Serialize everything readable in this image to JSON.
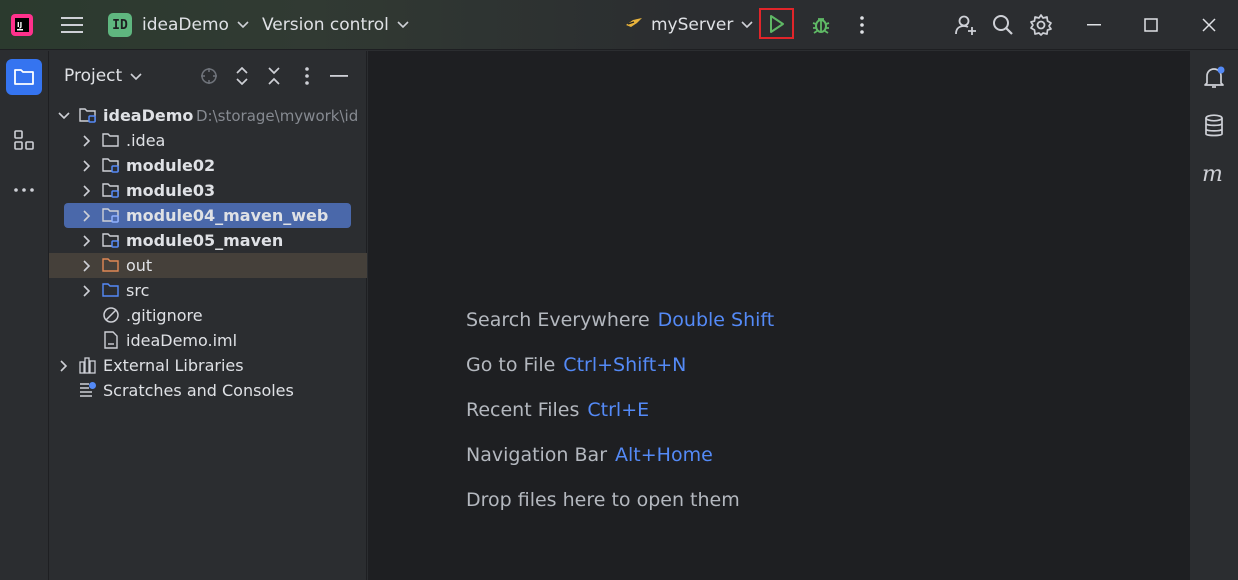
{
  "titlebar": {
    "project_badge": "ID",
    "project_name": "ideaDemo",
    "vcs_label": "Version control",
    "run_config": "myServer"
  },
  "project_panel": {
    "title": "Project"
  },
  "tree": [
    {
      "label": "ideaDemo",
      "path": "D:\\storage\\mywork\\id",
      "depth": 0,
      "expanded": true,
      "type": "module",
      "bold": true
    },
    {
      "label": ".idea",
      "depth": 1,
      "type": "folder"
    },
    {
      "label": "module02",
      "depth": 1,
      "type": "module",
      "bold": true
    },
    {
      "label": "module03",
      "depth": 1,
      "type": "module",
      "bold": true
    },
    {
      "label": "module04_maven_web",
      "depth": 1,
      "type": "module",
      "bold": true,
      "selected": true
    },
    {
      "label": "module05_maven",
      "depth": 1,
      "type": "module",
      "bold": true
    },
    {
      "label": "out",
      "depth": 1,
      "type": "excluded-folder",
      "excluded": true
    },
    {
      "label": "src",
      "depth": 1,
      "type": "source-folder"
    },
    {
      "label": ".gitignore",
      "depth": 1,
      "type": "ignore-file",
      "leaf": true
    },
    {
      "label": "ideaDemo.iml",
      "depth": 1,
      "type": "iml-file",
      "leaf": true
    },
    {
      "label": "External Libraries",
      "depth": 0,
      "type": "libraries"
    },
    {
      "label": "Scratches and Consoles",
      "depth": 0,
      "type": "scratches",
      "leaf": true
    }
  ],
  "editor_hints": [
    {
      "text": "Search Everywhere",
      "key": "Double Shift"
    },
    {
      "text": "Go to File",
      "key": "Ctrl+Shift+N"
    },
    {
      "text": "Recent Files",
      "key": "Ctrl+E"
    },
    {
      "text": "Navigation Bar",
      "key": "Alt+Home"
    },
    {
      "text": "Drop files here to open them",
      "key": ""
    }
  ],
  "colors": {
    "accent": "#3574f0",
    "run_highlight": "#e0252a",
    "run_green": "#5fb865",
    "shortcut": "#548af7"
  },
  "icons": {
    "left_strip": [
      "project-folder-icon",
      "structure-icon",
      "more-tools-icon"
    ],
    "right_strip": [
      "notifications-icon",
      "database-icon",
      "maven-icon"
    ],
    "titlebar_right": [
      "code-with-me-icon",
      "search-icon",
      "settings-icon",
      "minimize-icon",
      "maximize-icon",
      "close-icon"
    ]
  }
}
